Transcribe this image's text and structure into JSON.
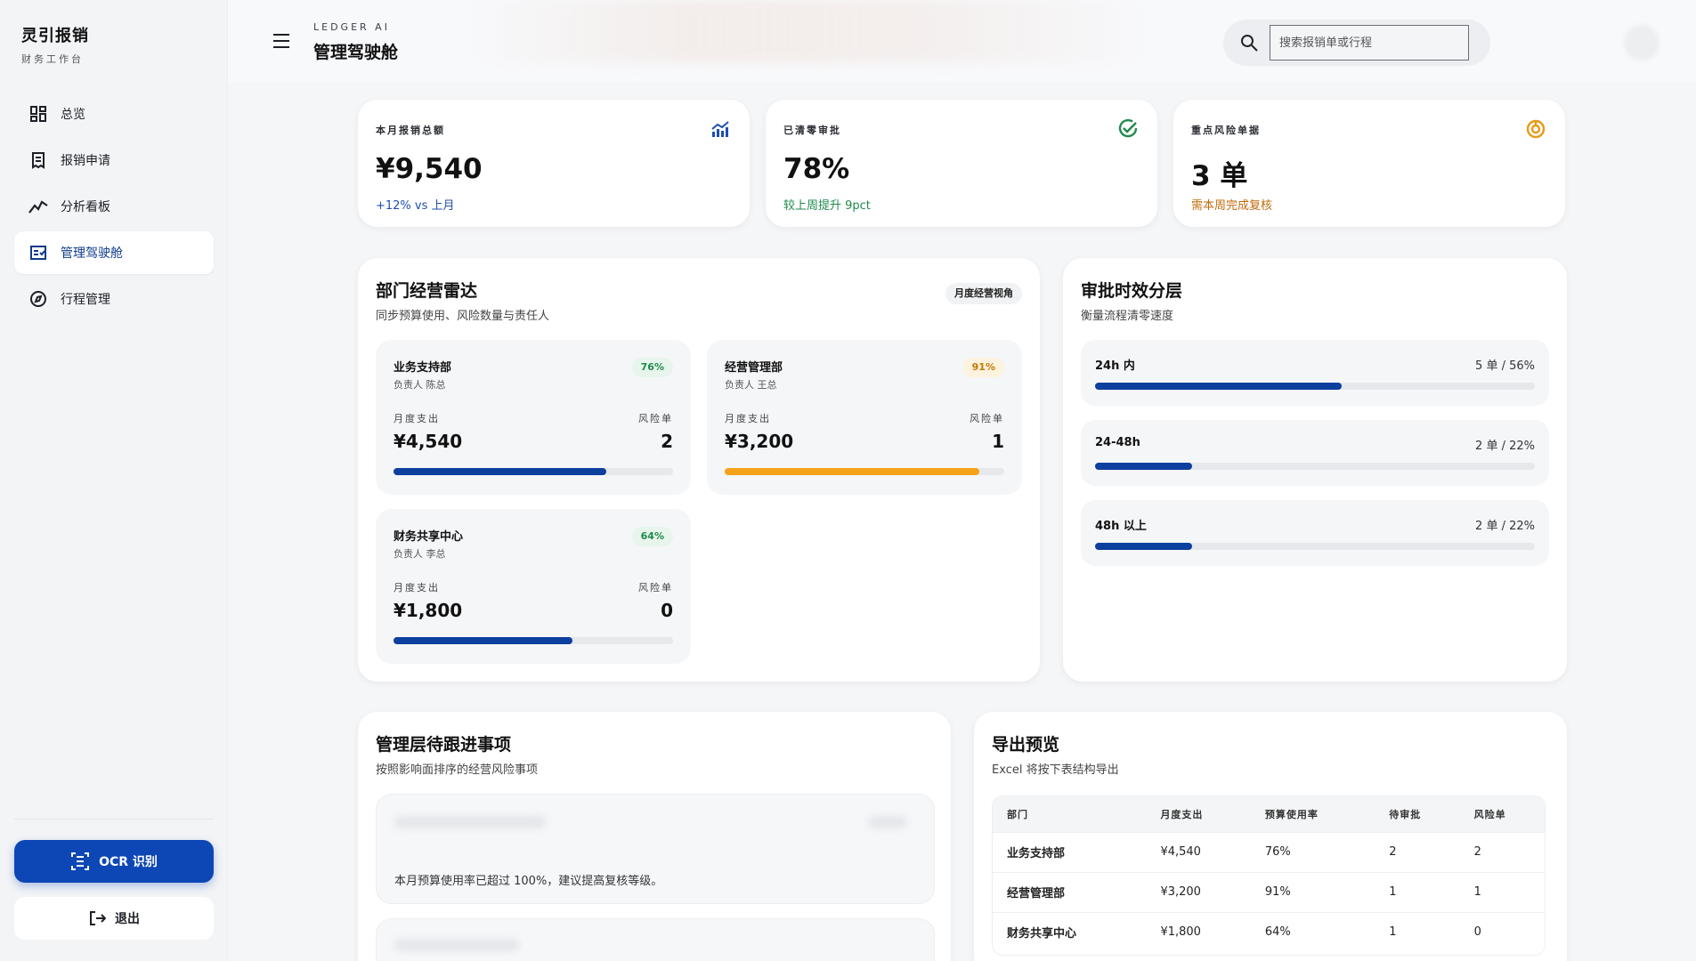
{
  "sidebar": {
    "brand_title": "灵引报销",
    "brand_sub": "财务工作台",
    "items": [
      {
        "label": "总览",
        "icon": "dashboard-grid-icon",
        "active": false
      },
      {
        "label": "报销申请",
        "icon": "receipt-icon",
        "active": false
      },
      {
        "label": "分析看板",
        "icon": "trend-line-icon",
        "active": false
      },
      {
        "label": "管理驾驶舱",
        "icon": "checklist-icon",
        "active": true
      },
      {
        "label": "行程管理",
        "icon": "compass-icon",
        "active": false
      }
    ],
    "ocr_label": "OCR 识别",
    "logout_label": "退出"
  },
  "header": {
    "kicker": "LEDGER AI",
    "title": "管理驾驶舱",
    "search_placeholder": "搜索报销单或行程"
  },
  "kpis": [
    {
      "label": "本月报销总额",
      "value": "¥9,540",
      "sub": "+12% vs 上月",
      "sub_color": "#1f4fae",
      "icon": "chart-up-icon",
      "icon_color": "#1f4fae"
    },
    {
      "label": "已清零审批",
      "value": "78%",
      "sub": "较上周提升 9pct",
      "sub_color": "#1f8a4c",
      "icon": "check-circle-icon",
      "icon_color": "#1f8a4c"
    },
    {
      "label": "重点风险单据",
      "value": "3 单",
      "sub": "需本周完成复核",
      "sub_color": "#c06a0a",
      "icon": "warning-ring-icon",
      "icon_color": "#e59a16"
    }
  ],
  "radar": {
    "title": "部门经营雷达",
    "subtitle": "同步预算使用、风险数量与责任人",
    "pill": "月度经营视角",
    "spend_label": "月度支出",
    "risk_label": "风险单",
    "depts": [
      {
        "name": "业务支持部",
        "owner": "负责人 陈总",
        "pct_label": "76%",
        "usage": 0.76,
        "amount": "¥4,540",
        "risk": "2",
        "bar_color": "#0d3f9e",
        "pct_color": "#1f8a4c",
        "pct_bg": "#e7f5ec"
      },
      {
        "name": "经营管理部",
        "owner": "负责人 王总",
        "pct_label": "91%",
        "usage": 0.91,
        "amount": "¥3,200",
        "risk": "1",
        "bar_color": "#f5a21b",
        "pct_color": "#c47a06",
        "pct_bg": "#fdf2dd"
      },
      {
        "name": "财务共享中心",
        "owner": "负责人 李总",
        "pct_label": "64%",
        "usage": 0.64,
        "amount": "¥1,800",
        "risk": "0",
        "bar_color": "#0d3f9e",
        "pct_color": "#1f8a4c",
        "pct_bg": "#e7f5ec"
      }
    ]
  },
  "sla": {
    "title": "审批时效分层",
    "subtitle": "衡量流程清零速度",
    "tiers": [
      {
        "name": "24h 内",
        "value": "5 单 / 56%",
        "share": 0.56
      },
      {
        "name": "24-48h",
        "value": "2 单 / 22%",
        "share": 0.22
      },
      {
        "name": "48h 以上",
        "value": "2 单 / 22%",
        "share": 0.22
      }
    ]
  },
  "todo": {
    "title": "管理层待跟进事项",
    "subtitle": "按照影响面排序的经营风险事项",
    "items": [
      {
        "text": "本月预算使用率已超过 100%，建议提高复核等级。"
      }
    ]
  },
  "export": {
    "title": "导出预览",
    "subtitle": "Excel 将按下表结构导出",
    "columns": [
      "部门",
      "月度支出",
      "预算使用率",
      "待审批",
      "风险单"
    ],
    "rows": [
      [
        "业务支持部",
        "¥4,540",
        "76%",
        "2",
        "2"
      ],
      [
        "经营管理部",
        "¥3,200",
        "91%",
        "1",
        "1"
      ],
      [
        "财务共享中心",
        "¥1,800",
        "64%",
        "1",
        "0"
      ]
    ]
  }
}
